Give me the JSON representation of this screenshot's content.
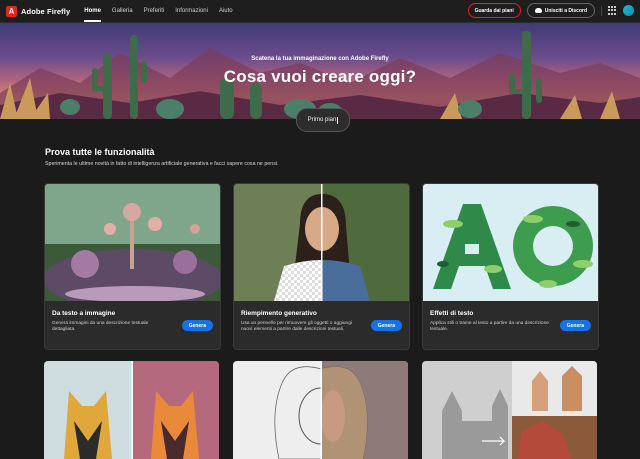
{
  "app": {
    "brand": "Adobe Firefly",
    "logo_letter": "A"
  },
  "nav": [
    {
      "label": "Home",
      "active": true
    },
    {
      "label": "Galleria",
      "active": false
    },
    {
      "label": "Preferiti",
      "active": false
    },
    {
      "label": "Informazioni",
      "active": false
    },
    {
      "label": "Aiuto",
      "active": false
    }
  ],
  "topbar": {
    "plans_label": "Guarda dai piani",
    "discord_label": "Unisciti a Discord"
  },
  "hero": {
    "subtitle": "Scatena la tua immaginazione con Adobe Firefly",
    "title": "Cosa vuoi creare oggi?",
    "pill_text": "Primo pian"
  },
  "section": {
    "title": "Prova tutte le funzionalità",
    "description": "Sperimenta le ultime novità in fatto di intelligenza artificiale generativa e facci sapere cosa ne pensi."
  },
  "cards": [
    {
      "title": "Da testo a immagine",
      "description": "Genera immagini da una descrizione testuale dettagliata.",
      "button": "Genera"
    },
    {
      "title": "Riempimento generativo",
      "description": "Usa un pennello per rimuovere gli oggetti o aggiungi nuovi elementi a partire dalle descrizioni testuali.",
      "button": "Genera"
    },
    {
      "title": "Effetti di testo",
      "description": "Applica stili o trame al testo a partire da una descrizione testuale.",
      "button": "Genera"
    }
  ],
  "colors": {
    "accent_red": "#e1251b",
    "button_blue": "#1473e6",
    "background": "#1b1b1b"
  }
}
